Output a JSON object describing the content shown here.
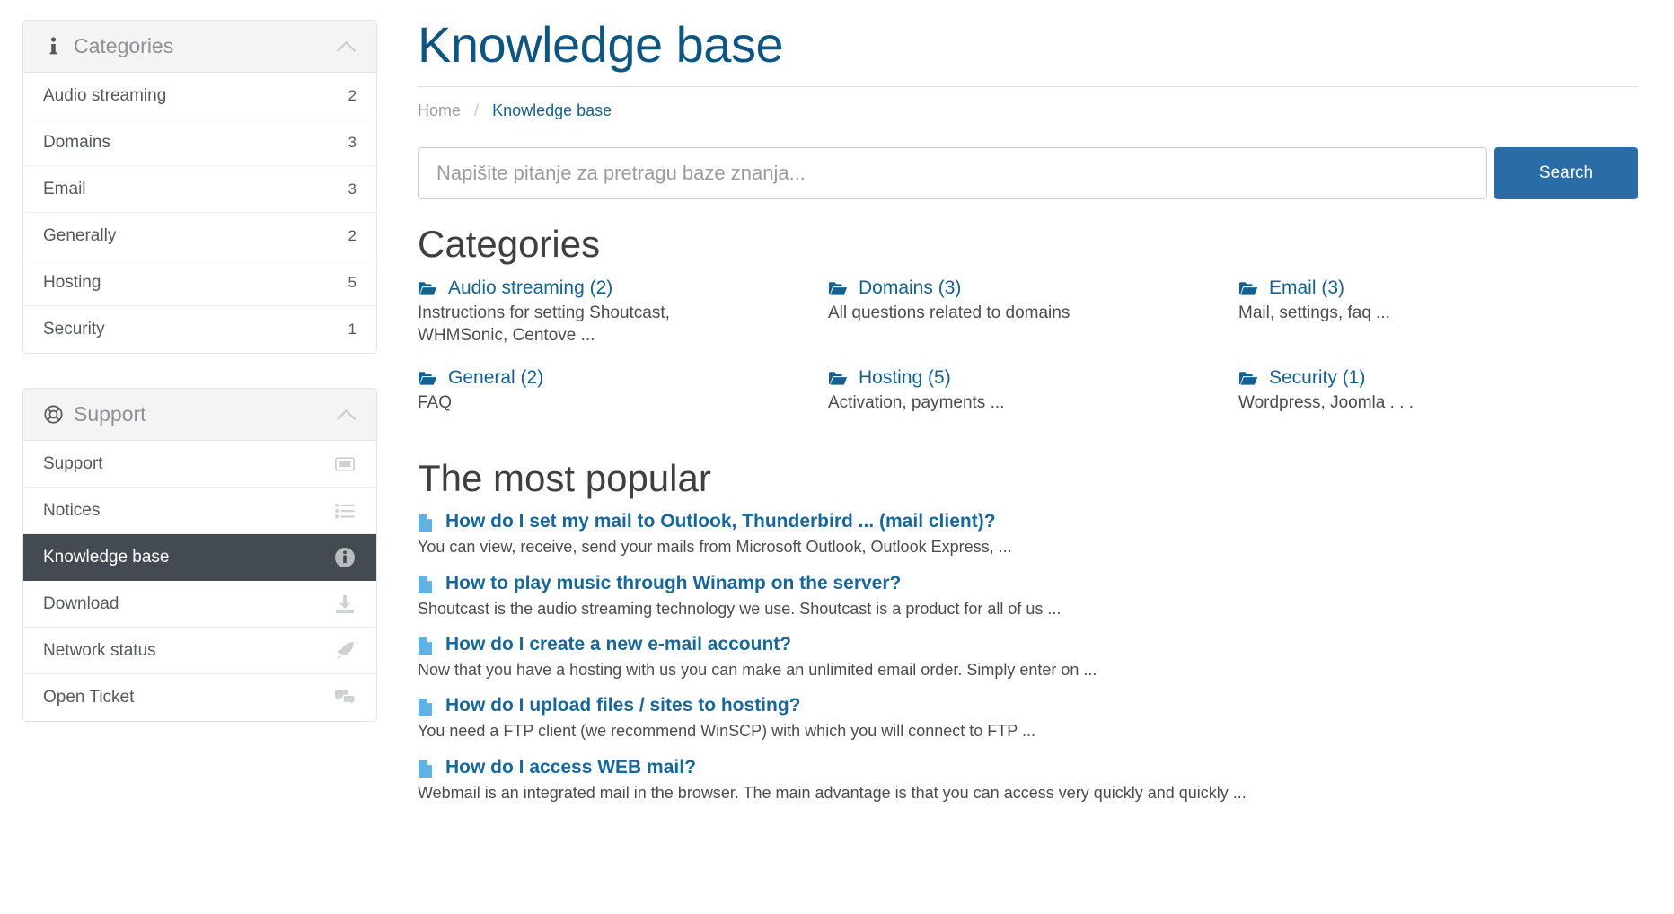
{
  "sidebar": {
    "categories_panel": {
      "title": "Categories",
      "head_icon": "info-icon",
      "collapse_icon": "chevron-up-icon",
      "items": [
        {
          "label": "Audio streaming",
          "count": "2"
        },
        {
          "label": "Domains",
          "count": "3"
        },
        {
          "label": "Email",
          "count": "3"
        },
        {
          "label": "Generally",
          "count": "2"
        },
        {
          "label": "Hosting",
          "count": "5"
        },
        {
          "label": "Security",
          "count": "1"
        }
      ]
    },
    "support_panel": {
      "title": "Support",
      "head_icon": "life-ring-icon",
      "collapse_icon": "chevron-up-icon",
      "items": [
        {
          "label": "Support",
          "icon": "ticket-icon",
          "active": false
        },
        {
          "label": "Notices",
          "icon": "list-icon",
          "active": false
        },
        {
          "label": "Knowledge base",
          "icon": "info-circle-icon",
          "active": true
        },
        {
          "label": "Download",
          "icon": "download-icon",
          "active": false
        },
        {
          "label": "Network status",
          "icon": "rocket-icon",
          "active": false
        },
        {
          "label": "Open Ticket",
          "icon": "comments-icon",
          "active": false
        }
      ]
    }
  },
  "main": {
    "title": "Knowledge base",
    "breadcrumb": {
      "home": "Home",
      "separator": "/",
      "current": "Knowledge base"
    },
    "search": {
      "placeholder": "Napišite pitanje za pretragu baze znanja...",
      "value": "",
      "button_label": "Search"
    },
    "categories_section": {
      "heading": "Categories",
      "items": [
        {
          "name": "Audio streaming (2)",
          "desc": "Instructions for setting Shoutcast, WHMSonic, Centove ...",
          "icon": "folder-open-icon"
        },
        {
          "name": "Domains (3)",
          "desc": "All questions related to domains",
          "icon": "folder-open-icon"
        },
        {
          "name": "Email (3)",
          "desc": "Mail, settings, faq ...",
          "icon": "folder-open-icon"
        },
        {
          "name": "General (2)",
          "desc": "FAQ",
          "icon": "folder-open-icon"
        },
        {
          "name": "Hosting (5)",
          "desc": "Activation, payments ...",
          "icon": "folder-open-icon"
        },
        {
          "name": "Security (1)",
          "desc": "Wordpress, Joomla . . .",
          "icon": "folder-open-icon"
        }
      ]
    },
    "popular_section": {
      "heading": "The most popular",
      "articles": [
        {
          "title": "How do I set my mail to Outlook, Thunderbird ... (mail client)?",
          "excerpt": "You can view, receive, send your mails from Microsoft Outlook, Outlook Express, ...",
          "icon": "document-icon"
        },
        {
          "title": "How to play music through Winamp on the server?",
          "excerpt": "Shoutcast is the audio streaming technology we use. Shoutcast is a product for all of us ...",
          "icon": "document-icon"
        },
        {
          "title": "How do I create a new e-mail account?",
          "excerpt": "Now that you have a hosting with us you can make an unlimited email order. Simply enter on ...",
          "icon": "document-icon"
        },
        {
          "title": "How do I upload files / sites to hosting?",
          "excerpt": "You need a FTP client (we recommend WinSCP) with which you will connect to FTP ...",
          "icon": "document-icon"
        },
        {
          "title": "How do I access WEB mail?",
          "excerpt": "Webmail is an integrated mail in the browser. The main advantage is that you can access very quickly and quickly ...",
          "icon": "document-icon"
        }
      ]
    }
  },
  "colors": {
    "title_blue": "#0f5582",
    "link_blue": "#14618f",
    "button_blue": "#2a6ca5",
    "active_row": "#434a52",
    "doc_icon_blue": "#5fb3e4"
  }
}
